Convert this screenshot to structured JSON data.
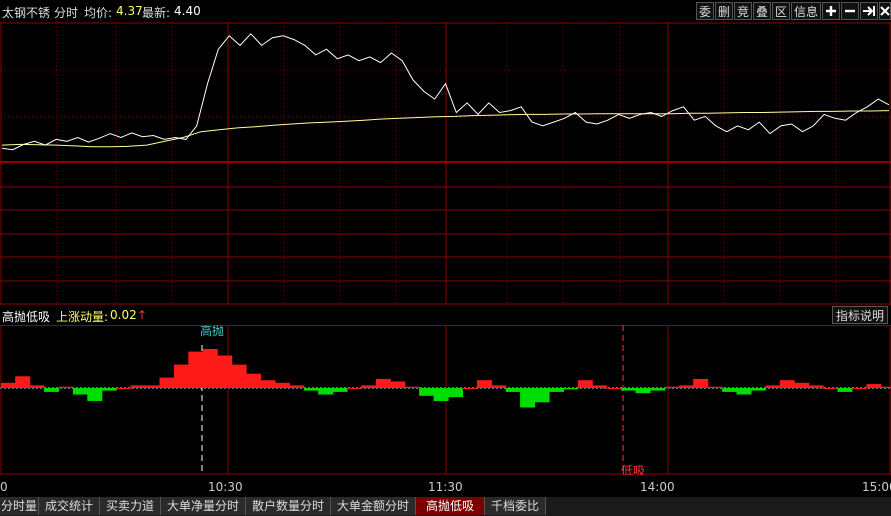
{
  "header": {
    "stock_name": "太钢不锈",
    "mode": "分时",
    "avg_label": "均价:",
    "avg_value": "4.37",
    "latest_label": "最新:",
    "latest_value": "4.40"
  },
  "toolbar": {
    "buttons": [
      "委",
      "删",
      "竞",
      "叠",
      "区",
      "信息"
    ],
    "icon_buttons": [
      "plus-icon",
      "minus-icon",
      "collapse-right-icon",
      "close-icon"
    ]
  },
  "indicator": {
    "name": "高抛低吸",
    "param_label": "上涨动量:",
    "param_value": "0.02",
    "explain_button": "指标说明",
    "sell_marker": "高抛",
    "buy_marker": "低吸"
  },
  "time_axis": [
    "0",
    "10:30",
    "11:30",
    "14:00",
    "15:00"
  ],
  "tabs": [
    "分时量",
    "成交统计",
    "买卖力道",
    "大单净量分时",
    "散户数量分时",
    "大单金额分时",
    "高抛低吸",
    "千档委比"
  ],
  "active_tab": "高抛低吸",
  "colors": {
    "grid": "#8b0000",
    "price_line": "#ffffff",
    "avg_line": "#ffff99",
    "up": "#ff1a1a",
    "down": "#00dd00",
    "sell_marker": "#44cccc",
    "buy_marker": "#ff3333"
  },
  "chart_data": [
    {
      "type": "line",
      "series": [
        {
          "values": [
            0.62,
            0.58,
            0.72,
            0.8,
            0.7,
            0.85,
            0.8,
            0.9,
            0.78,
            0.88,
            1.0,
            0.9,
            1.02,
            0.92,
            0.95,
            0.85,
            0.9,
            0.85,
            1.2,
            2.3,
            3.2,
            3.55,
            3.3,
            3.6,
            3.3,
            3.5,
            3.55,
            3.45,
            3.3,
            3.05,
            3.2,
            2.95,
            3.05,
            2.9,
            3.0,
            2.85,
            3.1,
            2.9,
            2.4,
            2.1,
            1.9,
            2.3,
            1.55,
            1.8,
            1.5,
            1.8,
            1.55,
            1.6,
            1.7,
            1.3,
            1.2,
            1.3,
            1.4,
            1.55,
            1.3,
            1.25,
            1.35,
            1.5,
            1.4,
            1.5,
            1.55,
            1.45,
            1.6,
            1.7,
            1.35,
            1.45,
            1.2,
            1.05,
            1.2,
            1.1,
            1.3,
            1.0,
            1.2,
            1.25,
            1.05,
            1.2,
            1.5,
            1.4,
            1.35,
            1.55,
            1.7,
            1.9,
            1.75
          ]
        },
        {
          "values": [
            0.7,
            0.72,
            0.71,
            0.7,
            0.68,
            0.66,
            0.66,
            0.67,
            0.7,
            0.8,
            0.9,
            1.05,
            1.1,
            1.15,
            1.18,
            1.22,
            1.25,
            1.28,
            1.3,
            1.32,
            1.35,
            1.38,
            1.4,
            1.42,
            1.44,
            1.45,
            1.47,
            1.48,
            1.49,
            1.5,
            1.5,
            1.51,
            1.51,
            1.52,
            1.52,
            1.52,
            1.52,
            1.52,
            1.53,
            1.53,
            1.54,
            1.55,
            1.55,
            1.56,
            1.57,
            1.58,
            1.58,
            1.59,
            1.59,
            1.6
          ]
        }
      ]
    },
    {
      "type": "area",
      "values": [
        0.4,
        0.9,
        0.2,
        -0.3,
        0.1,
        -0.5,
        -1.0,
        -0.2,
        0.0,
        0.2,
        0.2,
        0.8,
        1.8,
        2.8,
        3.0,
        2.5,
        1.8,
        1.1,
        0.6,
        0.4,
        0.2,
        -0.2,
        -0.5,
        -0.3,
        0.0,
        0.2,
        0.7,
        0.5,
        0.1,
        -0.6,
        -1.0,
        -0.7,
        0.0,
        0.6,
        0.2,
        -0.3,
        -1.5,
        -1.1,
        -0.3,
        -0.1,
        0.6,
        0.2,
        0.0,
        -0.2,
        -0.4,
        -0.2,
        0.1,
        0.2,
        0.7,
        0.1,
        -0.3,
        -0.5,
        -0.2,
        0.2,
        0.6,
        0.4,
        0.2,
        0.0,
        -0.3,
        0.0,
        0.3,
        0.1
      ]
    }
  ]
}
